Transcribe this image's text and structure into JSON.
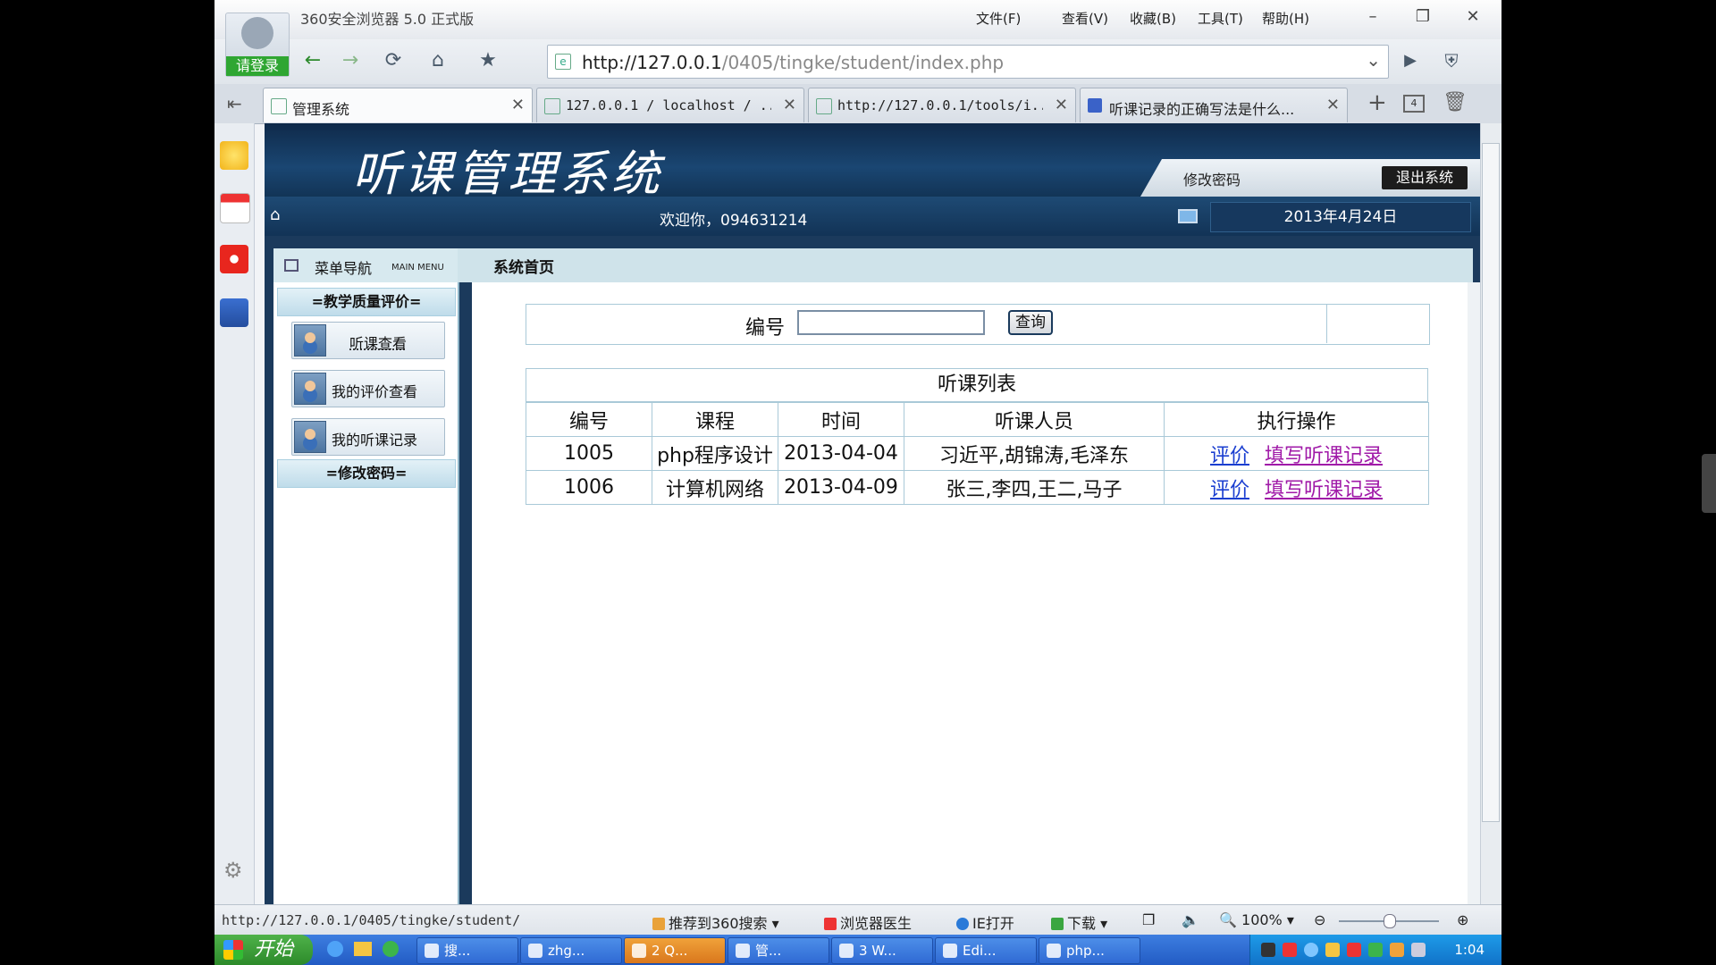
{
  "browser": {
    "login_label": "请登录",
    "app_title": "360安全浏览器 5.0 正式版",
    "menus": [
      "文件(F)",
      "查看(V)",
      "收藏(B)",
      "工具(T)",
      "帮助(H)"
    ],
    "url_host": "http://127.0.0.1",
    "url_path": "/0405/tingke/student/index.php",
    "tabs": [
      {
        "label": "管理系统"
      },
      {
        "label": "127.0.0.1 / localhost / ..."
      },
      {
        "label": "http://127.0.0.1/tools/i..."
      },
      {
        "label": "听课记录的正确写法是什么..."
      }
    ],
    "tab_count_badge": "4",
    "status_url": "http://127.0.0.1/0405/tingke/student/",
    "status_items": [
      "推荐到360搜索",
      "浏览器医生",
      "IE打开",
      "下载"
    ],
    "zoom": "100%"
  },
  "site": {
    "banner_title": "听课管理系统",
    "change_password": "修改密码",
    "logout": "退出系统",
    "welcome": "欢迎你，094631214",
    "date": "2013年4月24日",
    "menu_nav_label": "菜单导航",
    "menu_nav_sub": "MAIN MENU",
    "menu_section_1": "=教学质量评价=",
    "menu_items": [
      "听课查看",
      "我的评价查看",
      "我的听课记录"
    ],
    "menu_section_2": "=修改密码=",
    "content_title": "系统首页",
    "search_label": "编号",
    "search_value": "",
    "search_button": "查询",
    "list_caption": "听课列表",
    "columns": [
      "编号",
      "课程",
      "时间",
      "听课人员",
      "执行操作"
    ],
    "rows": [
      {
        "id": "1005",
        "course": "php程序设计",
        "date": "2013-04-04",
        "observers": "习近平,胡锦涛,毛泽东",
        "action_eval": "评价",
        "action_record": "填写听课记录"
      },
      {
        "id": "1006",
        "course": "计算机网络",
        "date": "2013-04-09",
        "observers": "张三,李四,王二,马子",
        "action_eval": "评价",
        "action_record": "填写听课记录"
      }
    ]
  },
  "taskbar": {
    "start_label": "开始",
    "tasks": [
      "搜...",
      "zhg...",
      "2 Q...",
      "管...",
      "3 W...",
      "Edi...",
      "php..."
    ],
    "clock": "1:04"
  }
}
